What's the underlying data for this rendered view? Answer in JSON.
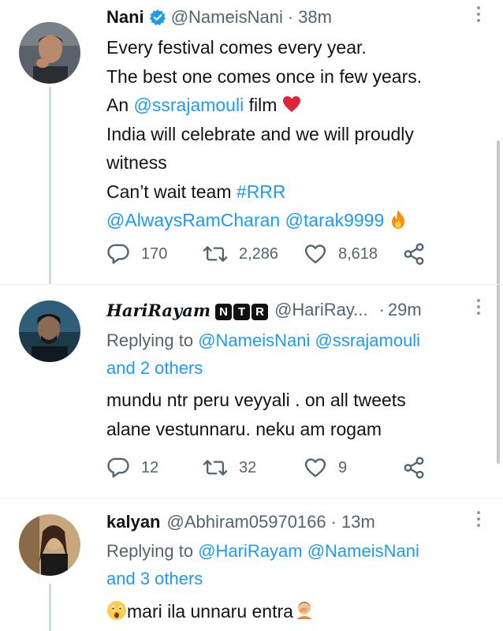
{
  "tweets": [
    {
      "name": "Nani",
      "handle": "@NameisNani",
      "dot": "·",
      "time": "38m",
      "lines": [
        "Every festival comes every year.",
        "The best one comes once in few years."
      ],
      "line3_pre": "An ",
      "line3_link": "@ssrajamouli",
      "line3_post": " film ",
      "line4": "India will celebrate and we will proudly",
      "line5": "witness",
      "line6_pre": "Can’t wait team ",
      "line6_link": "#RRR",
      "line7_link1": "@AlwaysRamCharan",
      "line7_link2": "@tarak9999",
      "replies": "170",
      "retweets": "2,286",
      "likes": "8,618"
    },
    {
      "name": "HariRayam",
      "badges": [
        "N",
        "T",
        "R"
      ],
      "handle": "@HariRay...",
      "dot": "·",
      "time": "29m",
      "replying_label": "Replying to",
      "replying_handles": [
        "@NameisNani",
        "@ssrajamouli"
      ],
      "replying_others": "and 2 others",
      "lines": [
        "mundu ntr peru veyyali . on all tweets",
        "alane vestunnaru. neku am rogam"
      ],
      "replies": "12",
      "retweets": "32",
      "likes": "9"
    },
    {
      "name": "kalyan",
      "handle": "@Abhiram05970166",
      "dot": "·",
      "time": "13m",
      "replying_label": "Replying to",
      "replying_handles": [
        "@HariRayam",
        "@NameisNani"
      ],
      "replying_others": "and 3 others",
      "text": "mari ila unnaru entra"
    }
  ],
  "icons": [
    "verified-icon",
    "more-icon",
    "reply-icon",
    "retweet-icon",
    "like-icon",
    "share-icon",
    "heart-emoji-icon",
    "fire-emoji-icon",
    "astonished-emoji-icon",
    "facepalm-emoji-icon"
  ],
  "colors": {
    "accent": "#1d9bf0",
    "muted": "#536471",
    "text": "#0f1419",
    "heart_emoji": "#e0243a",
    "fire": "#f4900c"
  }
}
